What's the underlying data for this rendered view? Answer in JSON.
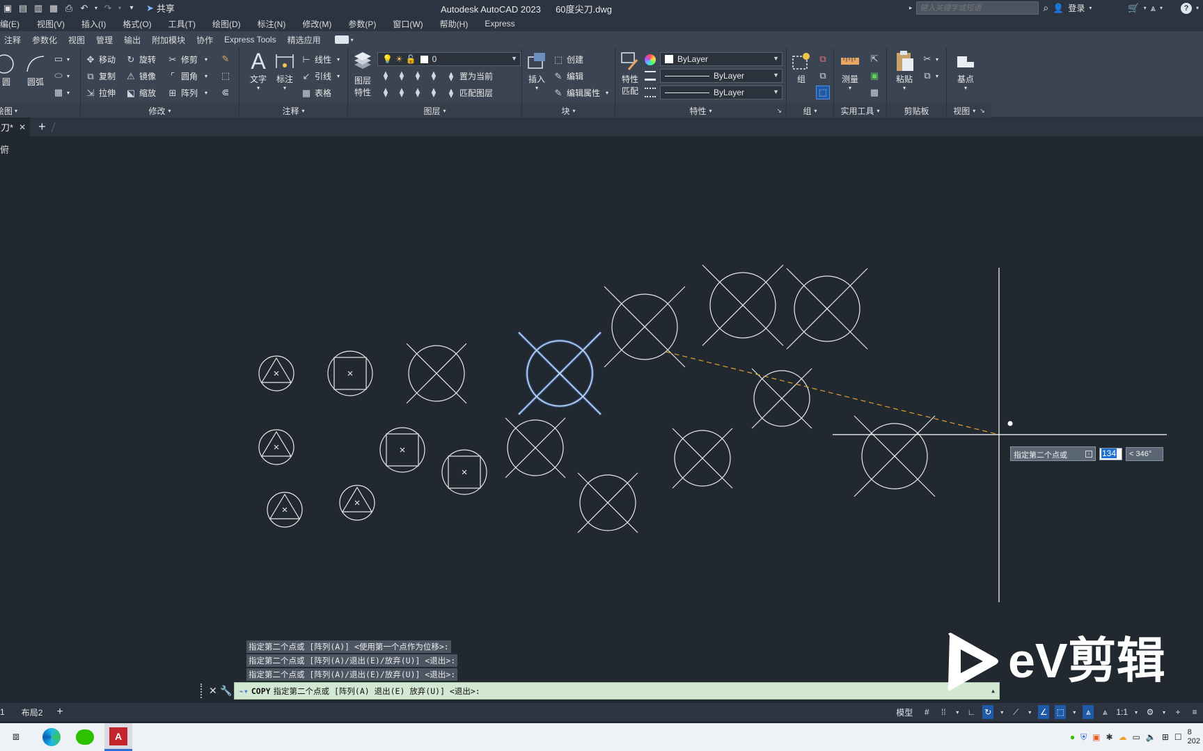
{
  "titlebar": {
    "app_title": "Autodesk AutoCAD 2023",
    "doc_title": "60度尖刀.dwg",
    "share_label": "共享",
    "search_placeholder": "键入关键字或短语",
    "login_label": "登录"
  },
  "menu": {
    "items": [
      "编(E)",
      "视图(V)",
      "插入(I)",
      "格式(O)",
      "工具(T)",
      "绘图(D)",
      "标注(N)",
      "修改(M)",
      "参数(P)",
      "窗口(W)",
      "帮助(H)",
      "Express"
    ]
  },
  "ribbon_tabs": {
    "items": [
      "注释",
      "参数化",
      "视图",
      "管理",
      "输出",
      "附加模块",
      "协作",
      "Express Tools",
      "精选应用"
    ]
  },
  "ribbon": {
    "draw": {
      "circle": "圆",
      "arc": "圆弧",
      "footer": "绘图"
    },
    "modify": {
      "move": "移动",
      "rotate": "旋转",
      "trim": "修剪",
      "copy": "复制",
      "mirror": "镜像",
      "fillet": "圆角",
      "stretch": "拉伸",
      "scale": "缩放",
      "array": "阵列",
      "footer": "修改"
    },
    "annotation": {
      "text": "文字",
      "dimension": "标注",
      "linear": "线性",
      "leader": "引线",
      "table": "表格",
      "footer": "注释"
    },
    "layers": {
      "layer_props_1": "图层",
      "layer_props_2": "特性",
      "current_layer": "0",
      "set_current": "置为当前",
      "match_layer": "匹配图层",
      "footer": "图层"
    },
    "block": {
      "insert": "插入",
      "create": "创建",
      "edit": "编辑",
      "edit_attr": "编辑属性",
      "footer": "块"
    },
    "properties": {
      "match_1": "特性",
      "match_2": "匹配",
      "color": "ByLayer",
      "linetype": "ByLayer",
      "lineweight": "ByLayer",
      "footer": "特性"
    },
    "groups": {
      "group": "组",
      "footer": "组"
    },
    "utilities": {
      "measure": "测量",
      "footer": "实用工具"
    },
    "clipboard": {
      "paste": "粘贴",
      "footer": "剪贴板"
    },
    "view": {
      "base": "基点",
      "footer": "视图"
    }
  },
  "filetabs": {
    "current": "尖刀*",
    "add": "+"
  },
  "viewport": {
    "label": "俯"
  },
  "dynamic_input": {
    "prompt": "指定第二个点或",
    "value": "134",
    "angle": "< 346°"
  },
  "command": {
    "history": [
      "指定第二个点或 [阵列(A)] <使用第一个点作为位移>:",
      "指定第二个点或 [阵列(A)/退出(E)/放弃(U)] <退出>:",
      "指定第二个点或 [阵列(A)/退出(E)/放弃(U)] <退出>:"
    ],
    "current_cmd": "COPY",
    "current_prompt": "指定第二个点或 [阵列(A) 退出(E) 放弃(U)] <退出>:"
  },
  "layout_tabs": {
    "items": [
      "1",
      "布局2"
    ],
    "add": "+"
  },
  "statusbar": {
    "model_label": "模型",
    "scale_label": "1:1"
  },
  "watermark": {
    "text": "eV剪辑"
  },
  "taskbar": {
    "clock_line1": "8",
    "clock_line2": "202"
  },
  "colors": {
    "canvas": "#212830",
    "ribbon": "#3b4452",
    "selection": "#5a8fe0",
    "rubberband": "#e0a030",
    "cmd_input_bg": "#d2e8d2"
  }
}
